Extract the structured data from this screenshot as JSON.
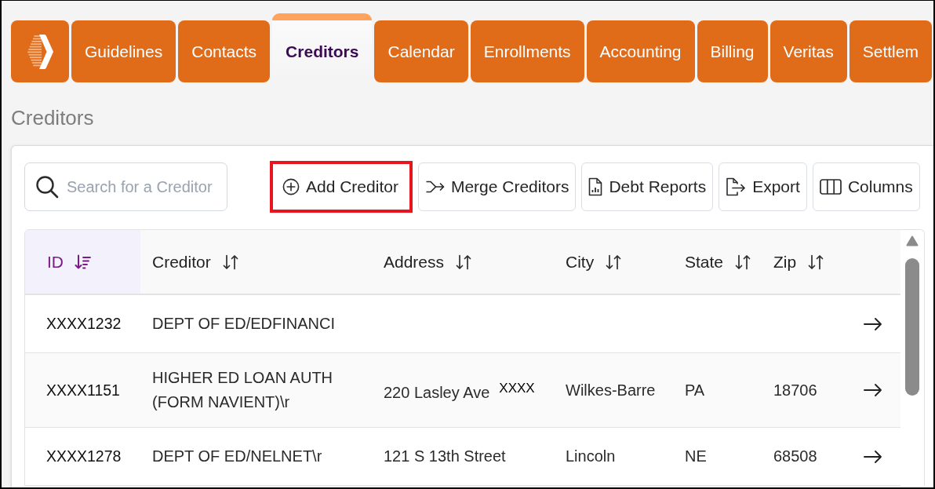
{
  "tabs": [
    {
      "label": "Guidelines",
      "selected": false
    },
    {
      "label": "Contacts",
      "selected": false
    },
    {
      "label": "Creditors",
      "selected": true
    },
    {
      "label": "Calendar",
      "selected": false
    },
    {
      "label": "Enrollments",
      "selected": false
    },
    {
      "label": "Accounting",
      "selected": false
    },
    {
      "label": "Billing",
      "selected": false
    },
    {
      "label": "Veritas",
      "selected": false
    },
    {
      "label": "Settlem",
      "selected": false
    }
  ],
  "page_title": "Creditors",
  "toolbar": {
    "search": {
      "placeholder": "Search for a Creditor"
    },
    "buttons": [
      {
        "kind": "add",
        "label": "Add Creditor",
        "highlighted": true
      },
      {
        "kind": "merge",
        "label": "Merge Creditors",
        "highlighted": false
      },
      {
        "kind": "report",
        "label": "Debt Reports",
        "highlighted": false
      },
      {
        "kind": "export",
        "label": "Export",
        "highlighted": false
      },
      {
        "kind": "columns",
        "label": "Columns",
        "highlighted": false
      }
    ]
  },
  "table": {
    "columns": [
      {
        "label": "ID",
        "sorted": true
      },
      {
        "label": "Creditor",
        "sorted": false
      },
      {
        "label": "Address",
        "sorted": false
      },
      {
        "label": "City",
        "sorted": false
      },
      {
        "label": "State",
        "sorted": false
      },
      {
        "label": "Zip",
        "sorted": false
      }
    ],
    "rows": [
      {
        "id": "XXXX1232",
        "creditor": "DEPT OF ED/EDFINANCI"
      },
      {
        "id": "XXXX1151",
        "creditor": "HIGHER ED LOAN AUTH (FORM NAVIENT)\\r",
        "address": "220 Lasley Ave",
        "address_note": "XXXX",
        "city": "Wilkes-Barre",
        "state": "PA",
        "zip": "18706"
      },
      {
        "id": "XXXX1278",
        "creditor": "DEPT OF ED/NELNET\\r",
        "address": "121 S 13th Street",
        "city": "Lincoln",
        "state": "NE",
        "zip": "68508"
      }
    ]
  }
}
